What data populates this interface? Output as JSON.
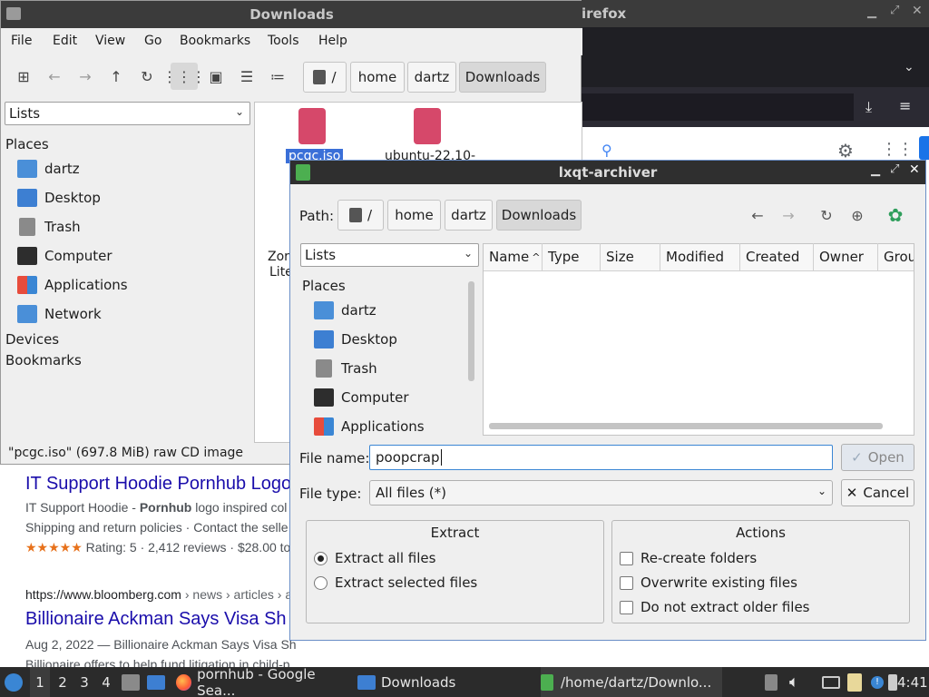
{
  "firefox": {
    "title": "irefox"
  },
  "results": {
    "r1_title": "IT Support Hoodie Pornhub Logo",
    "r1_snip_a": "IT Support Hoodie - ",
    "r1_snip_b": "Pornhub",
    "r1_snip_c": " logo inspired col",
    "r1_snip2": "Shipping and return policies · Contact the selle",
    "r1_stars": "★★★★★",
    "r1_rating": " Rating: 5 · 2,412 reviews · $28.00 to",
    "r2_url": "https://www.bloomberg.com",
    "r2_path": " › news › articles › a",
    "r2_title": "Billionaire Ackman Says Visa Sh",
    "r2_snip": "Aug 2, 2022 — Billionaire Ackman Says Visa Sh",
    "r2_snip2": "Billionaire offers to help fund litigation in child-p"
  },
  "fm": {
    "title": "Downloads",
    "menu": [
      "File",
      "Edit",
      "View",
      "Go",
      "Bookmarks",
      "Tools",
      "Help"
    ],
    "breadcrumb": [
      "/",
      "home",
      "dartz",
      "Downloads"
    ],
    "side_combo": "Lists",
    "places_label": "Places",
    "places": [
      "dartz",
      "Desktop",
      "Trash",
      "Computer",
      "Applications",
      "Network"
    ],
    "devices_label": "Devices",
    "bookmarks_label": "Bookmarks",
    "files": [
      {
        "name": "pcgc.iso"
      },
      {
        "name": "ubuntu-22.10-"
      }
    ],
    "partial_label_a": "Zor",
    "partial_label_b": "Lite",
    "status": "\"pcgc.iso\" (697.8 MiB) raw CD image"
  },
  "dialog": {
    "title": "lxqt-archiver",
    "path_label": "Path:",
    "breadcrumb": [
      "/",
      "home",
      "dartz",
      "Downloads"
    ],
    "side_combo": "Lists",
    "places_label": "Places",
    "places": [
      "dartz",
      "Desktop",
      "Trash",
      "Computer",
      "Applications"
    ],
    "columns": [
      "Name",
      "Type",
      "Size",
      "Modified",
      "Created",
      "Owner",
      "Grou"
    ],
    "file_name_label": "File name:",
    "file_name_value": "poopcrap",
    "file_type_label": "File type:",
    "file_type_value": "All files (*)",
    "open_label": "Open",
    "cancel_label": "Cancel",
    "extract_title": "Extract",
    "extract_all": "Extract all files",
    "extract_selected": "Extract selected files",
    "actions_title": "Actions",
    "recreate": "Re-create folders",
    "overwrite": "Overwrite existing files",
    "no_older": "Do not extract older files"
  },
  "taskbar": {
    "workspaces": [
      "1",
      "2",
      "3",
      "4"
    ],
    "task_firefox": "pornhub - Google Sea...",
    "task_fm": "Downloads",
    "task_archiver": "/home/dartz/Downlo...",
    "clock": "4:41"
  },
  "colors": {
    "accent": "#3a86d4",
    "iso_icon": "#d6486a",
    "selection": "#3a6fd8"
  }
}
